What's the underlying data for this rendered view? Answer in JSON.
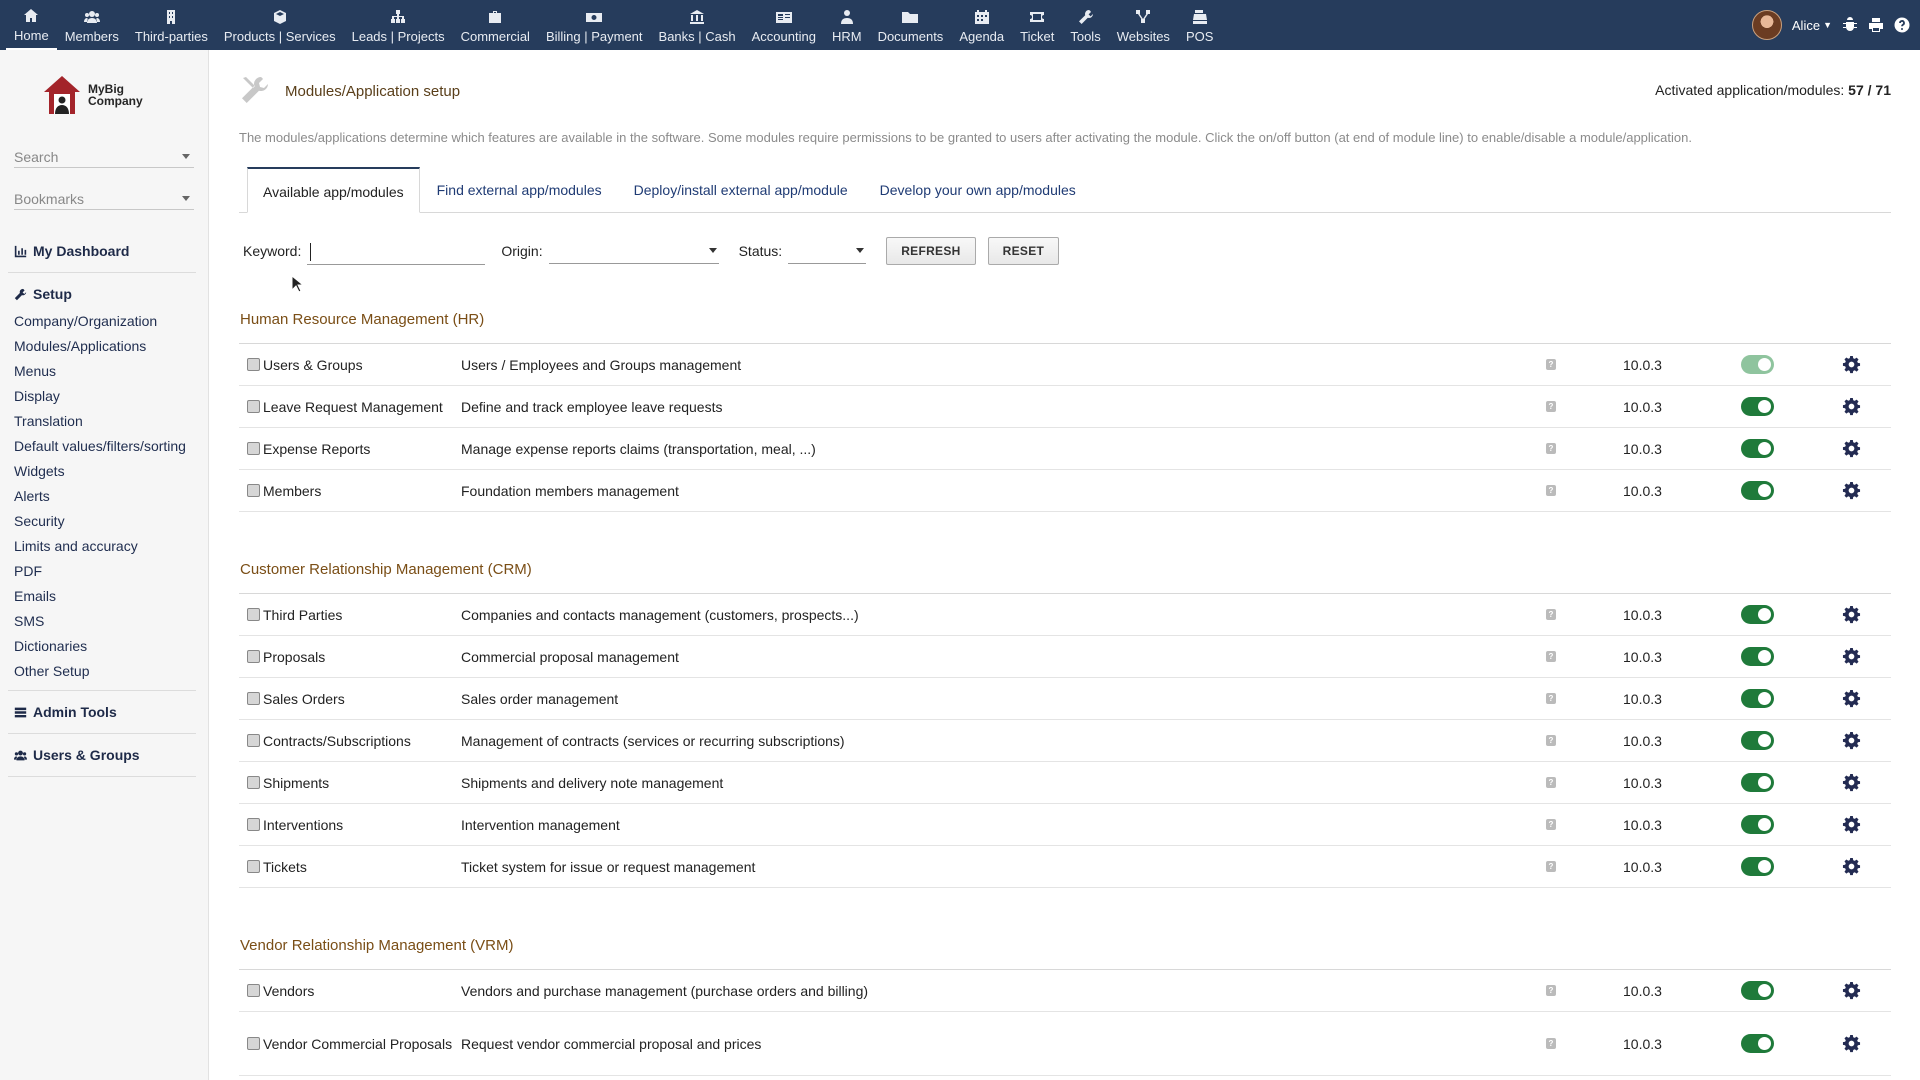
{
  "topnav": [
    {
      "label": "Home",
      "icon": "home-icon"
    },
    {
      "label": "Members",
      "icon": "members-icon"
    },
    {
      "label": "Third-parties",
      "icon": "building-icon"
    },
    {
      "label": "Products | Services",
      "icon": "cube-icon"
    },
    {
      "label": "Leads | Projects",
      "icon": "sitemap-icon"
    },
    {
      "label": "Commercial",
      "icon": "briefcase-icon"
    },
    {
      "label": "Billing | Payment",
      "icon": "money-icon"
    },
    {
      "label": "Banks | Cash",
      "icon": "bank-icon"
    },
    {
      "label": "Accounting",
      "icon": "accounting-icon"
    },
    {
      "label": "HRM",
      "icon": "user-tie-icon"
    },
    {
      "label": "Documents",
      "icon": "folder-icon"
    },
    {
      "label": "Agenda",
      "icon": "calendar-icon"
    },
    {
      "label": "Ticket",
      "icon": "ticket-icon"
    },
    {
      "label": "Tools",
      "icon": "wrench-icon"
    },
    {
      "label": "Websites",
      "icon": "network-icon"
    },
    {
      "label": "POS",
      "icon": "cash-register-icon"
    }
  ],
  "user": {
    "name": "Alice"
  },
  "logo": {
    "line1": "MyBig",
    "line2": "Company"
  },
  "sidebar": {
    "search_placeholder": "Search",
    "bookmarks_placeholder": "Bookmarks",
    "dashboard": "My Dashboard",
    "setup": "Setup",
    "setup_items": [
      "Company/Organization",
      "Modules/Applications",
      "Menus",
      "Display",
      "Translation",
      "Default values/filters/sorting",
      "Widgets",
      "Alerts",
      "Security",
      "Limits and accuracy",
      "PDF",
      "Emails",
      "SMS",
      "Dictionaries",
      "Other Setup"
    ],
    "admin_tools": "Admin Tools",
    "users_groups": "Users & Groups"
  },
  "page": {
    "title": "Modules/Application setup",
    "count_label": "Activated application/modules: ",
    "count_value": "57 / 71",
    "intro": "The modules/applications determine which features are available in the software. Some modules require permissions to be granted to users after activating the module. Click the on/off button (at end of module line) to enable/disable a module/application."
  },
  "tabs": [
    "Available app/modules",
    "Find external app/modules",
    "Deploy/install external app/module",
    "Develop your own app/modules"
  ],
  "filters": {
    "keyword_label": "Keyword:",
    "keyword_value": "",
    "origin_label": "Origin:",
    "origin_value": "",
    "status_label": "Status:",
    "status_value": "",
    "refresh": "REFRESH",
    "reset": "RESET"
  },
  "sections": [
    {
      "title": "Human Resource Management (HR)",
      "modules": [
        {
          "name": "Users & Groups",
          "desc": "Users / Employees and Groups management",
          "version": "10.0.3",
          "enabled": true,
          "locked": true
        },
        {
          "name": "Leave Request Management",
          "desc": "Define and track employee leave requests",
          "version": "10.0.3",
          "enabled": true
        },
        {
          "name": "Expense Reports",
          "desc": "Manage expense reports claims (transportation, meal, ...)",
          "version": "10.0.3",
          "enabled": true
        },
        {
          "name": "Members",
          "desc": "Foundation members management",
          "version": "10.0.3",
          "enabled": true
        }
      ]
    },
    {
      "title": "Customer Relationship Management (CRM)",
      "modules": [
        {
          "name": "Third Parties",
          "desc": "Companies and contacts management (customers, prospects...)",
          "version": "10.0.3",
          "enabled": true
        },
        {
          "name": "Proposals",
          "desc": "Commercial proposal management",
          "version": "10.0.3",
          "enabled": true
        },
        {
          "name": "Sales Orders",
          "desc": "Sales order management",
          "version": "10.0.3",
          "enabled": true
        },
        {
          "name": "Contracts/Subscriptions",
          "desc": "Management of contracts (services or recurring subscriptions)",
          "version": "10.0.3",
          "enabled": true
        },
        {
          "name": "Shipments",
          "desc": "Shipments and delivery note management",
          "version": "10.0.3",
          "enabled": true
        },
        {
          "name": "Interventions",
          "desc": "Intervention management",
          "version": "10.0.3",
          "enabled": true
        },
        {
          "name": "Tickets",
          "desc": "Ticket system for issue or request management",
          "version": "10.0.3",
          "enabled": true
        }
      ]
    },
    {
      "title": "Vendor Relationship Management (VRM)",
      "modules": [
        {
          "name": "Vendors",
          "desc": "Vendors and purchase management (purchase orders and billing)",
          "version": "10.0.3",
          "enabled": true
        },
        {
          "name": "Vendor Commercial Proposals",
          "desc": "Request vendor commercial proposal and prices",
          "version": "10.0.3",
          "enabled": true
        }
      ]
    }
  ],
  "colors": {
    "topbar": "#263c5c",
    "toggle_on": "#1f7a3a",
    "section_title": "#7a4e16",
    "link": "#1f3b74"
  }
}
